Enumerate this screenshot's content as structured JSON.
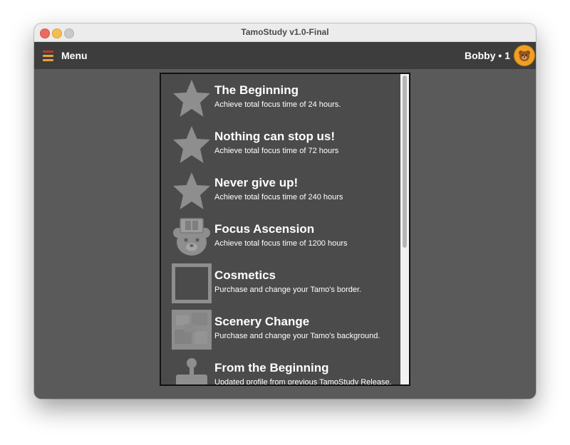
{
  "window": {
    "title": "TamoStudy v1.0-Final"
  },
  "toolbar": {
    "menu_label": "Menu",
    "user_label": "Bobby • 1"
  },
  "icons": {
    "menu": "hamburger-icon",
    "avatar": "bear-avatar-icon"
  },
  "colors": {
    "titlebar": "#ececec",
    "toolbar": "#3d3d3d",
    "background": "#5a5a5a",
    "panel": "#4b4b4b",
    "icon_gray": "#8e8e8e",
    "accent_orange": "#f0a020",
    "accent_red": "#c0392b"
  },
  "achievements": {
    "items": [
      {
        "title": "The Beginning",
        "description": "Achieve total focus time of 24 hours.",
        "icon": "star-icon"
      },
      {
        "title": "Nothing can stop us!",
        "description": "Achieve total focus time of 72 hours",
        "icon": "star-icon"
      },
      {
        "title": "Never give up!",
        "description": "Achieve total focus time of 240 hours",
        "icon": "star-icon"
      },
      {
        "title": "Focus Ascension",
        "description": "Achieve total focus time of 1200 hours",
        "icon": "bear-graduate-icon"
      },
      {
        "title": "Cosmetics",
        "description": "Purchase and change your Tamo's border.",
        "icon": "border-frame-icon"
      },
      {
        "title": "Scenery Change",
        "description": "Purchase and change your Tamo's background.",
        "icon": "scenery-icon"
      },
      {
        "title": "From the Beginning",
        "description": "Updated profile from previous TamoStudy Release.",
        "icon": "joystick-icon"
      }
    ]
  }
}
